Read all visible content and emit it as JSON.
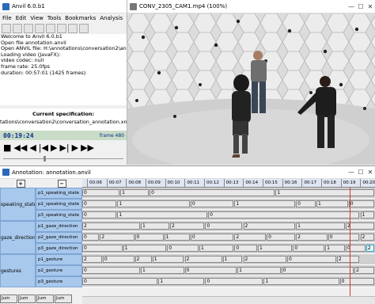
{
  "anvil": {
    "title": "Anvil 6.0.b1",
    "menus": [
      "File",
      "Edit",
      "View",
      "Tools",
      "Bookmarks",
      "Analysis",
      "?"
    ],
    "log_lines": [
      "Welcome to Anvil 6.0.b1",
      "Open file annotation.anvil",
      "Open ANVIL file: H:\\annotations\\conversation2\\anno",
      "Loading video (JavaFX):",
      "    video codec: null",
      "    frame rate: 25.0fps",
      "    duration: 00:57:01 (1425 frames)"
    ],
    "spec_heading": "Current specification:",
    "spec_path": "tations\\conversation2\\conversation_annotation.xml",
    "time": "00:19:24",
    "frame": "frame 480",
    "transport_icons": [
      "stop-icon",
      "rewind-fast-icon",
      "step-back-icon",
      "frame-back-icon",
      "play-icon",
      "frame-forward-icon",
      "step-forward-icon",
      "forward-fast-icon"
    ],
    "slider_position_fraction": 0.34
  },
  "video": {
    "title": "CONV_2305_CAM1.mp4 (100%)"
  },
  "annotation": {
    "title": "Annotation: annotation.anvil",
    "plus_label": "+",
    "minus_label": "−",
    "ticks": [
      "00:06",
      "00:07",
      "00:08",
      "00:09",
      "00:10",
      "00:11",
      "00:12",
      "00:13",
      "00:14",
      "00:15",
      "00:16",
      "00:17",
      "00:18",
      "00:19",
      "00:20"
    ],
    "groups": [
      {
        "label": "speaking_states",
        "tracks": [
          {
            "name": "p1_speaking_state",
            "segments": [
              "0",
              "1",
              "0",
              "1"
            ]
          },
          {
            "name": "p2_speaking_state",
            "segments": [
              "0",
              "1",
              "0",
              "1",
              "0",
              "1",
              "0"
            ]
          },
          {
            "name": "p3_speaking_state",
            "segments": [
              "0",
              "1",
              "0",
              "1"
            ]
          }
        ]
      },
      {
        "label": "gaze_directions",
        "tracks": [
          {
            "name": "p1_gaze_direction",
            "segments": [
              "2",
              "1",
              "2",
              "0",
              "2",
              "1",
              "2"
            ]
          },
          {
            "name": "p2_gaze_direction",
            "segments": [
              "0",
              "2",
              "0",
              "1",
              "0",
              "2",
              "0",
              "2",
              "0",
              "2"
            ]
          },
          {
            "name": "p3_gaze_direction",
            "segments": [
              "0",
              "1",
              "0",
              "1",
              "0",
              "1",
              "0",
              "1",
              "0",
              "2"
            ]
          }
        ]
      },
      {
        "label": "gestures",
        "tracks": [
          {
            "name": "p1_gesture",
            "segments": [
              "2",
              "0",
              "2",
              "1",
              "2",
              "1",
              "2",
              "0",
              "2"
            ]
          },
          {
            "name": "p2_gesture",
            "segments": [
              "0",
              "1",
              "0",
              "1",
              "0",
              "2"
            ]
          },
          {
            "name": "p3_gesture",
            "segments": [
              "0",
              "1",
              "0",
              "1",
              "0"
            ]
          }
        ]
      }
    ],
    "bottom_tabs": [
      "Jum",
      "Jum",
      "Jum",
      "Jum"
    ],
    "cursor_time": "00:19:24",
    "selection_color": "#2aa6c6",
    "cursor_color": "#e03030",
    "track_label_color": "#a8c8ec"
  }
}
